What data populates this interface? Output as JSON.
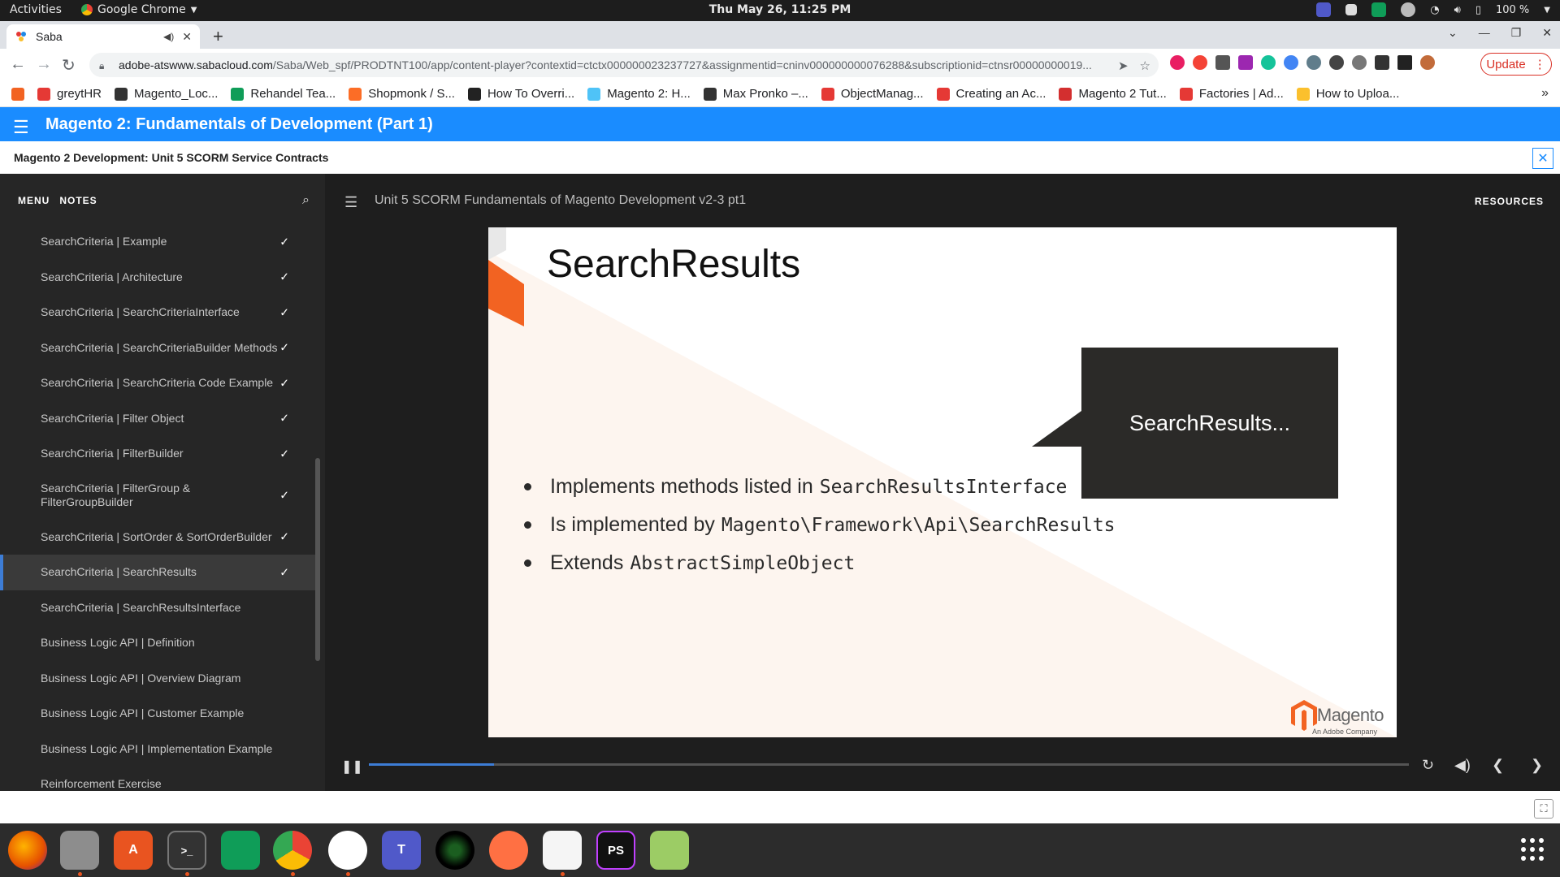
{
  "os": {
    "activities": "Activities",
    "app_name": "Google Chrome",
    "clock": "Thu May 26, 11:25 PM",
    "battery": "100 %"
  },
  "browser": {
    "tab_title": "Saba",
    "url_host": "adobe-atswww.sabacloud.com",
    "url_path": "/Saba/Web_spf/PRODTNT100/app/content-player?contextid=ctctx000000023237727&assignmentid=cninv000000000076288&subscriptionid=ctnsr00000000019...",
    "update_label": "Update",
    "bookmarks": [
      {
        "label": "greytHR",
        "color": "#e53935"
      },
      {
        "label": "Magento_Loc...",
        "color": "#333333"
      },
      {
        "label": "Rehandel Tea...",
        "color": "#0f9d58"
      },
      {
        "label": "Shopmonk / S...",
        "color": "#fc6d26"
      },
      {
        "label": "How To Overri...",
        "color": "#222222"
      },
      {
        "label": "Magento 2: H...",
        "color": "#4fc3f7"
      },
      {
        "label": "Max Pronko –...",
        "color": "#333333"
      },
      {
        "label": "ObjectManag...",
        "color": "#e53935"
      },
      {
        "label": "Creating an Ac...",
        "color": "#e53935"
      },
      {
        "label": "Magento 2 Tut...",
        "color": "#d32f2f"
      },
      {
        "label": "Factories | Ad...",
        "color": "#e53935"
      },
      {
        "label": "How to Uploa...",
        "color": "#fbc02d"
      }
    ]
  },
  "course": {
    "title": "Magento 2: Fundamentals of Development (Part 1)",
    "subtitle": "Magento 2 Development: Unit 5 SCORM Service Contracts"
  },
  "sidebar": {
    "tab_menu": "MENU",
    "tab_notes": "NOTES",
    "items": [
      {
        "label": "SearchCriteria | Example",
        "checked": "✓"
      },
      {
        "label": "SearchCriteria | Architecture",
        "checked": "✓"
      },
      {
        "label": "SearchCriteria | SearchCriteriaInterface",
        "checked": "✓"
      },
      {
        "label": "SearchCriteria | SearchCriteriaBuilder Methods",
        "checked": "✓"
      },
      {
        "label": "SearchCriteria | SearchCriteria Code Example",
        "checked": "✓"
      },
      {
        "label": "SearchCriteria | Filter Object",
        "checked": "✓"
      },
      {
        "label": "SearchCriteria | FilterBuilder",
        "checked": "✓"
      },
      {
        "label": "SearchCriteria | FilterGroup & FilterGroupBuilder",
        "checked": "✓"
      },
      {
        "label": "SearchCriteria | SortOrder & SortOrderBuilder",
        "checked": "✓"
      },
      {
        "label": "SearchCriteria | SearchResults",
        "checked": "✓"
      },
      {
        "label": "SearchCriteria | SearchResultsInterface",
        "checked": ""
      },
      {
        "label": "Business Logic API | Definition",
        "checked": ""
      },
      {
        "label": "Business Logic API | Overview Diagram",
        "checked": ""
      },
      {
        "label": "Business Logic API | Customer Example",
        "checked": ""
      },
      {
        "label": "Business Logic API | Implementation Example",
        "checked": ""
      },
      {
        "label": "Reinforcement Exercise",
        "checked": ""
      }
    ]
  },
  "content": {
    "title": "Unit 5 SCORM Fundamentals of Magento Development v2-3 pt1",
    "resources": "RESOURCES"
  },
  "slide": {
    "heading": "SearchResults",
    "callout": "SearchResults...",
    "bullets": [
      {
        "text": "Implements methods listed in",
        "code": "SearchResultsInterface"
      },
      {
        "text": "Is implemented by",
        "code": "Magento\\Framework\\Api\\SearchResults"
      },
      {
        "text": "Extends",
        "code": "AbstractSimpleObject"
      }
    ],
    "logo_word": "Magento",
    "logo_tag": "An Adobe Company"
  },
  "player": {
    "progress": 0.12
  }
}
